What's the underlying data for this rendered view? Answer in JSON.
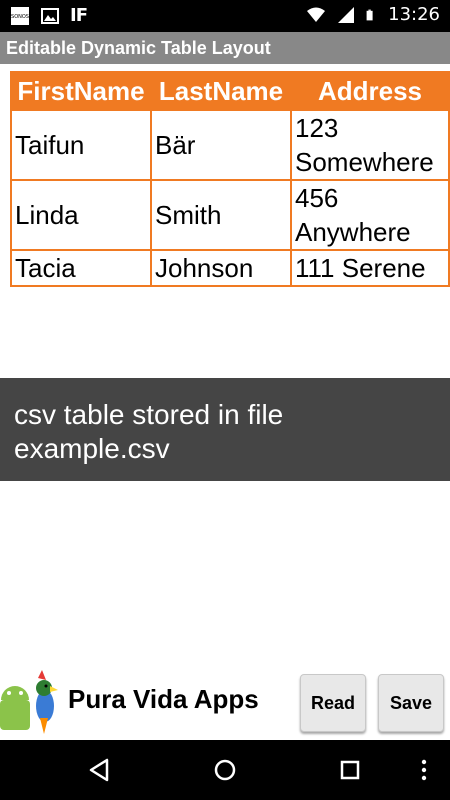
{
  "status_bar": {
    "time": "13:26",
    "left_icons": [
      "sonos-icon",
      "image-icon",
      "ifttt-icon"
    ],
    "ifttt_text": "IF",
    "sonos_text": "SONOS",
    "right_icons": [
      "wifi-icon",
      "signal-icon",
      "battery-icon"
    ]
  },
  "app": {
    "title": "Editable Dynamic Table Layout"
  },
  "table": {
    "headers": [
      "FirstName",
      "LastName",
      "Address"
    ],
    "rows": [
      [
        "Taifun",
        "Bär",
        "123 Somewhere"
      ],
      [
        "Linda",
        "Smith",
        "456 Anywhere"
      ],
      [
        "Tacia",
        "Johnson",
        "111 Serene"
      ]
    ]
  },
  "info": {
    "line1": "csv table stored in file",
    "line2": "example.csv"
  },
  "footer": {
    "brand": "Pura Vida Apps",
    "read_label": "Read",
    "save_label": "Save"
  },
  "colors": {
    "accent": "#f07a22",
    "title_bar": "#888888",
    "info_bar": "#454545"
  },
  "nav": {
    "icons": [
      "back-icon",
      "home-icon",
      "recents-icon",
      "overflow-menu-icon"
    ]
  }
}
